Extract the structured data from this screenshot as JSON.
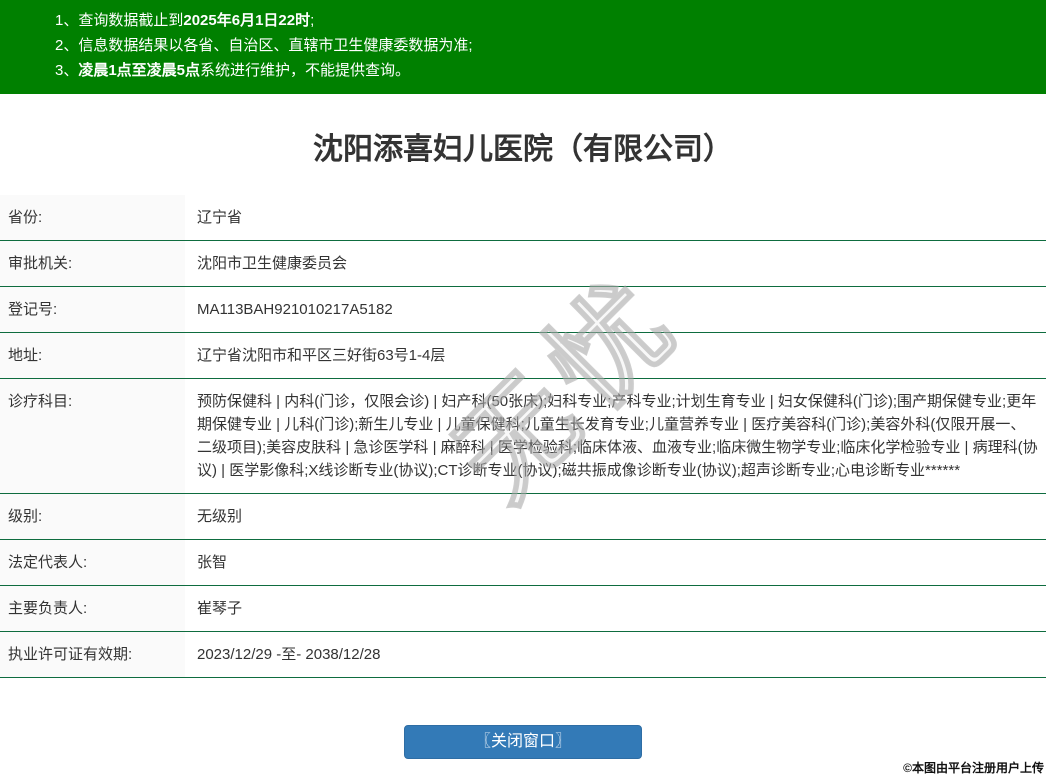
{
  "notices": [
    {
      "num": "1、",
      "pre": "查询数据截止到",
      "bold": "2025年6月1日22时",
      "post": ";"
    },
    {
      "num": "2、",
      "pre": "信息数据结果以各省、自治区、直辖市卫生健康委数据为准;",
      "bold": "",
      "post": ""
    },
    {
      "num": "3、",
      "pre": "",
      "bold": "凌晨1点至凌晨5点",
      "post": "系统进行维护，不能提供查询。"
    }
  ],
  "title": "沈阳添喜妇儿医院（有限公司）",
  "info_rows": [
    {
      "label": "省份:",
      "value": "辽宁省"
    },
    {
      "label": "审批机关:",
      "value": "沈阳市卫生健康委员会"
    },
    {
      "label": "登记号:",
      "value": "MA113BAH921010217A5182"
    },
    {
      "label": "地址:",
      "value": "辽宁省沈阳市和平区三好街63号1-4层"
    },
    {
      "label": "诊疗科目:",
      "value": "预防保健科 | 内科(门诊，仅限会诊) | 妇产科(50张床);妇科专业;产科专业;计划生育专业 | 妇女保健科(门诊);围产期保健专业;更年期保健专业 | 儿科(门诊);新生儿专业 | 儿童保健科;儿童生长发育专业;儿童营养专业 | 医疗美容科(门诊);美容外科(仅限开展一、二级项目);美容皮肤科 | 急诊医学科 | 麻醉科 | 医学检验科;临床体液、血液专业;临床微生物学专业;临床化学检验专业 | 病理科(协议) | 医学影像科;X线诊断专业(协议);CT诊断专业(协议);磁共振成像诊断专业(协议);超声诊断专业;心电诊断专业******"
    },
    {
      "label": "级别:",
      "value": "无级别"
    },
    {
      "label": "法定代表人:",
      "value": "张智"
    },
    {
      "label": "主要负责人:",
      "value": "崔琴子"
    },
    {
      "label": "执业许可证有效期:",
      "value": "2023/12/29 -至- 2038/12/28"
    }
  ],
  "close_button_label": "〖关闭窗口〗",
  "watermark_text": "无忧",
  "credit_text": "©本图由平台注册用户上传",
  "colors": {
    "header_green": "#008000",
    "row_border_green": "#0e6c3f",
    "button_blue": "#337ab7",
    "label_bg": "#fafafa"
  }
}
